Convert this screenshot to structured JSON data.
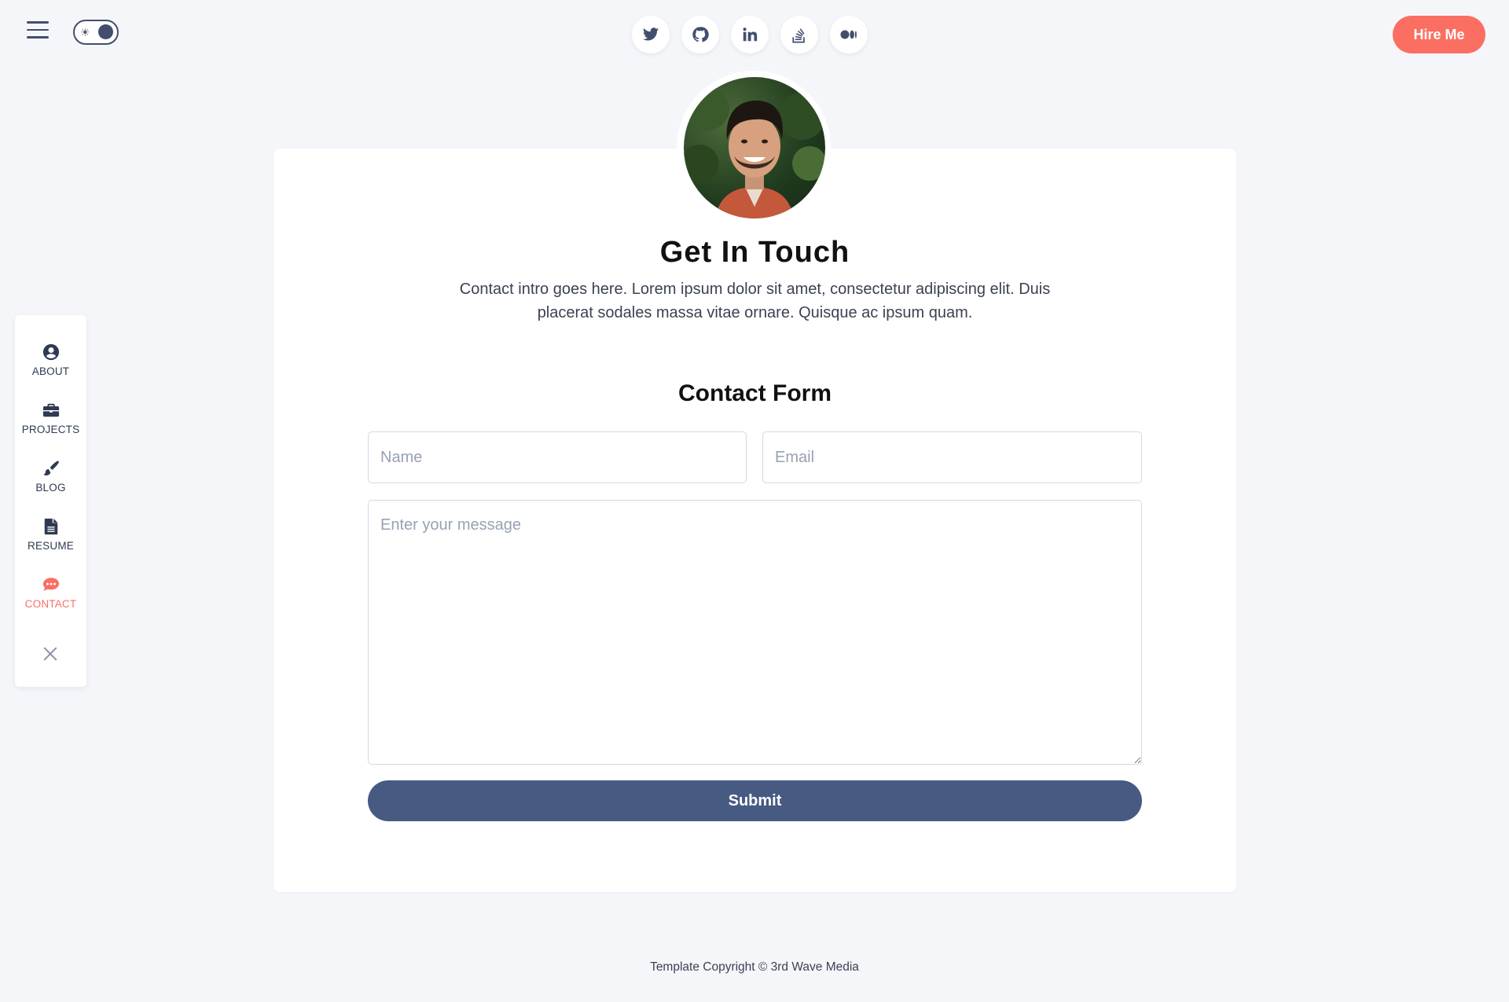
{
  "header": {
    "menu_icon": "hamburger-icon",
    "theme_toggle_icon": "sun-icon",
    "social": [
      {
        "name": "twitter",
        "icon": "twitter-icon"
      },
      {
        "name": "github",
        "icon": "github-icon"
      },
      {
        "name": "linkedin",
        "icon": "linkedin-icon"
      },
      {
        "name": "stackoverflow",
        "icon": "stackoverflow-icon"
      },
      {
        "name": "medium",
        "icon": "medium-icon"
      }
    ],
    "hire_label": "Hire Me"
  },
  "sidebar": {
    "items": [
      {
        "label": "ABOUT",
        "icon": "user-circle-icon",
        "active": false
      },
      {
        "label": "PROJECTS",
        "icon": "briefcase-icon",
        "active": false
      },
      {
        "label": "BLOG",
        "icon": "pen-icon",
        "active": false
      },
      {
        "label": "RESUME",
        "icon": "file-icon",
        "active": false
      },
      {
        "label": "CONTACT",
        "icon": "chat-icon",
        "active": true
      }
    ],
    "close_icon": "close-icon"
  },
  "main": {
    "title": "Get In Touch",
    "intro": "Contact intro goes here. Lorem ipsum dolor sit amet, consectetur adipiscing elit. Duis placerat sodales massa vitae ornare. Quisque ac ipsum quam.",
    "form_title": "Contact Form",
    "name_placeholder": "Name",
    "email_placeholder": "Email",
    "message_placeholder": "Enter your message",
    "submit_label": "Submit"
  },
  "footer": {
    "copyright": "Template Copyright © 3rd Wave Media"
  },
  "colors": {
    "accent": "#fb6f63",
    "primary": "#475a82",
    "background": "#f5f6fa"
  }
}
